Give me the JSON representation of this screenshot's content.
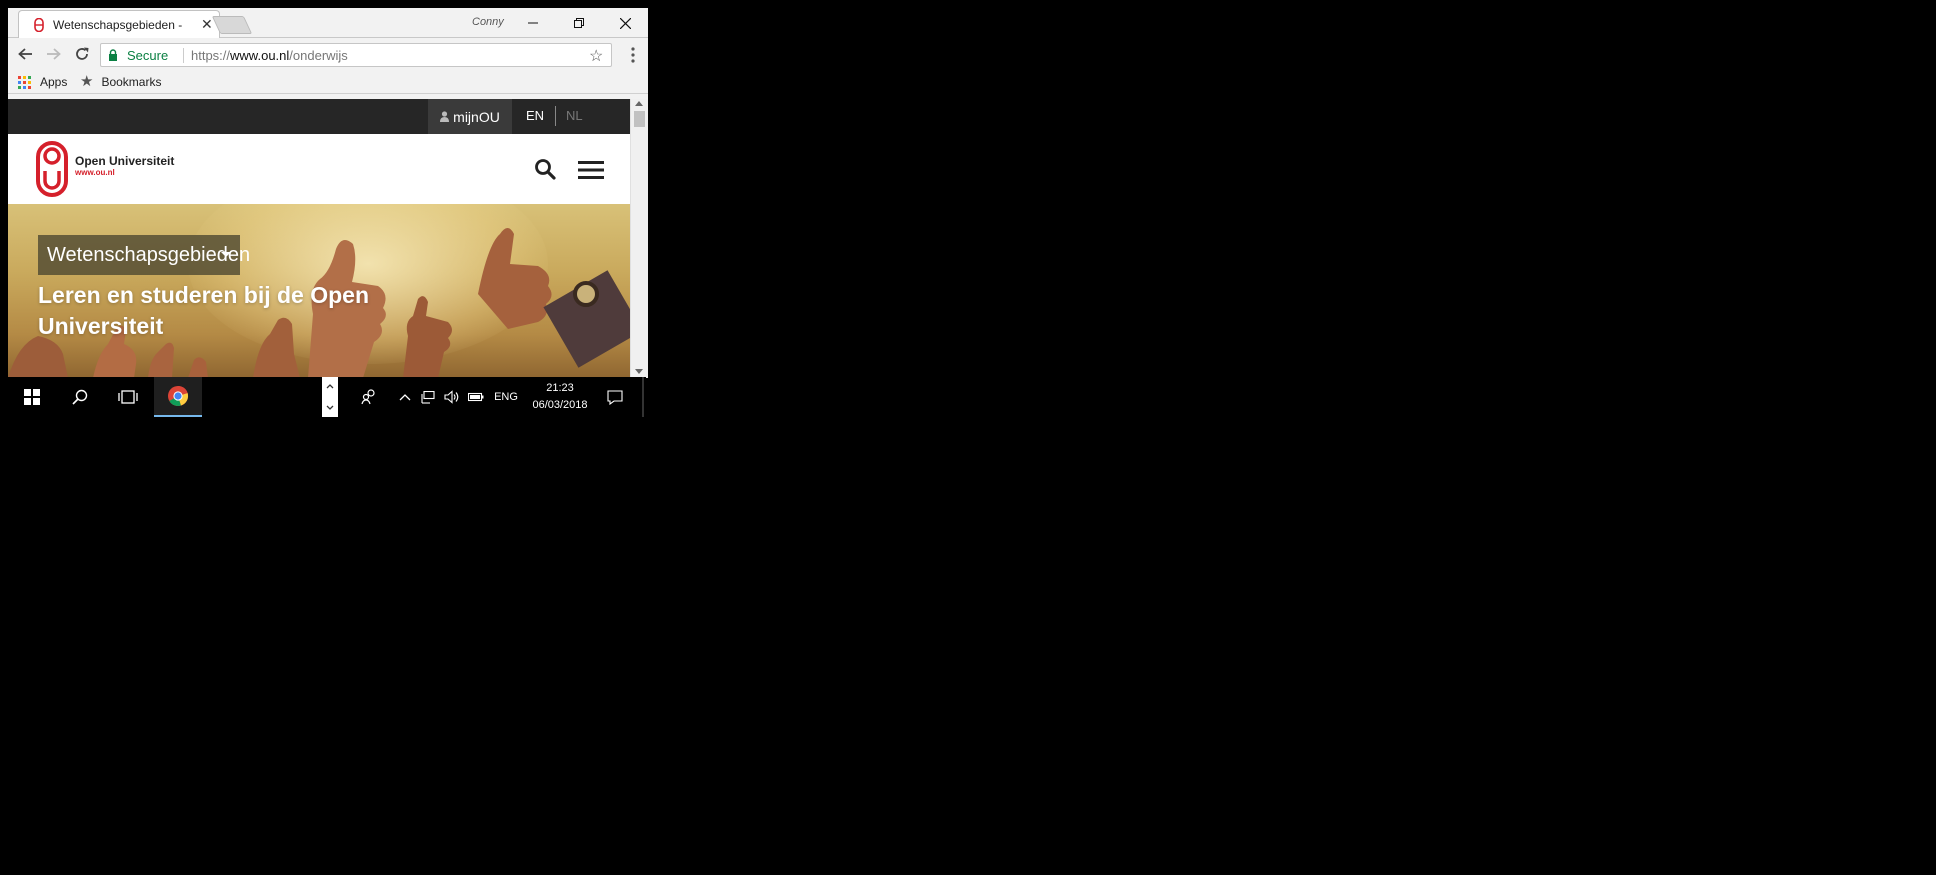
{
  "browser": {
    "tab_title": "Wetenschapsgebieden -",
    "profile_name": "Conny",
    "url_secure_label": "Secure",
    "url_scheme": "https://",
    "url_host": "www.ou.nl",
    "url_path": "/onderwijs",
    "bookmarks": [
      {
        "label": "Apps"
      },
      {
        "label": "Bookmarks"
      }
    ]
  },
  "site": {
    "topbar": {
      "account_label": "mijnOU",
      "lang_en": "EN",
      "lang_nl": "NL"
    },
    "logo": {
      "name": "Open Universiteit",
      "url": "www.ou.nl"
    },
    "hero": {
      "dropdown_label": "Wetenschapsgebieden",
      "heading": "Leren en studeren bij de Open Universiteit"
    }
  },
  "taskbar": {
    "language": "ENG",
    "time": "21:23",
    "date": "06/03/2018"
  },
  "colors": {
    "brand_red": "#d5202b",
    "topbar_bg": "#262626",
    "secure_green": "#0b8043",
    "active_task_underline": "#76b9ed"
  }
}
